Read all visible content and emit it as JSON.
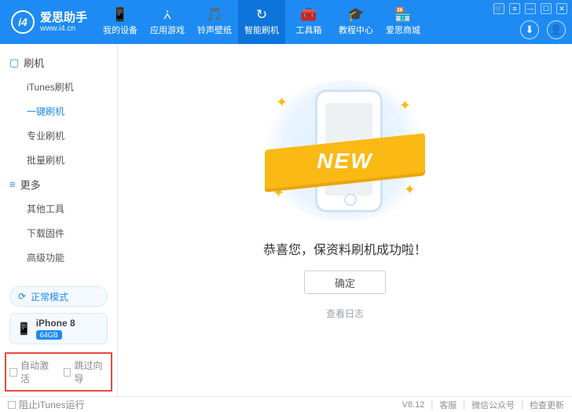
{
  "brand": {
    "logo_text": "i4",
    "title": "爱思助手",
    "url": "www.i4.cn"
  },
  "nav": [
    {
      "icon": "📱",
      "label": "我的设备"
    },
    {
      "icon": "⩑",
      "label": "应用游戏"
    },
    {
      "icon": "🎵",
      "label": "铃声壁纸"
    },
    {
      "icon": "↻",
      "label": "智能刷机",
      "active": true
    },
    {
      "icon": "🧰",
      "label": "工具箱"
    },
    {
      "icon": "🎓",
      "label": "教程中心"
    },
    {
      "icon": "🏪",
      "label": "爱思商城"
    }
  ],
  "titlebar_icons": [
    "🛒",
    "≡",
    "—",
    "☐",
    "✕"
  ],
  "header_circles": [
    "⬇",
    "👤"
  ],
  "sidebar": {
    "group1_label": "刷机",
    "group1_items": [
      "iTunes刷机",
      "一键刷机",
      "专业刷机",
      "批量刷机"
    ],
    "group1_active_index": 1,
    "group2_label": "更多",
    "group2_items": [
      "其他工具",
      "下载固件",
      "高级功能"
    ],
    "mode_label": "正常模式",
    "device": {
      "name": "iPhone 8",
      "storage": "64GB"
    },
    "opt_auto_activate": "自动激活",
    "opt_skip_guide": "跳过向导"
  },
  "main": {
    "ribbon_text": "NEW",
    "success_msg": "恭喜您，保资料刷机成功啦！",
    "ok_label": "确定",
    "view_log": "查看日志"
  },
  "footer": {
    "block_itunes": "阻止iTunes运行",
    "version": "V8.12",
    "links": [
      "客服",
      "微信公众号",
      "检查更新"
    ]
  }
}
